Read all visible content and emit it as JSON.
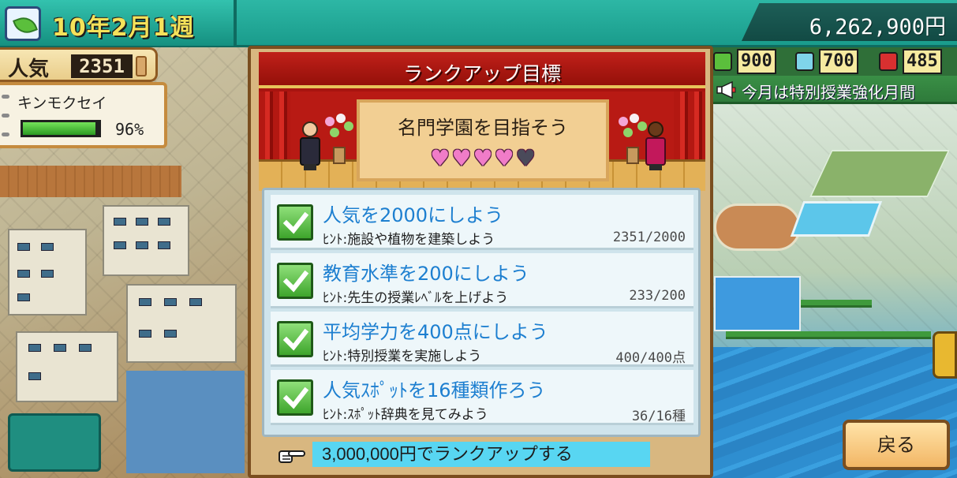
{
  "header": {
    "date": "10年2月1週",
    "money": "6,262,900円"
  },
  "popularity": {
    "label": "人気",
    "value": "2351"
  },
  "rival": {
    "name": "キンモクセイ",
    "percent_text": "96%",
    "percent": 96
  },
  "resources": [
    {
      "icon": "leaf-resource-icon",
      "value": "900",
      "color": "#5bbf3c"
    },
    {
      "icon": "flask-resource-icon",
      "value": "700",
      "color": "#7fd4ea"
    },
    {
      "icon": "book-resource-icon",
      "value": "485",
      "color": "#d83030"
    }
  ],
  "announcement": "今月は特別授業強化月間",
  "dialog": {
    "title": "ランクアップ目標",
    "goal_heading": "名門学園を目指そう",
    "hearts": {
      "filled": 4,
      "total": 5
    },
    "goals": [
      {
        "title": "人気を2000にしよう",
        "hint": "ﾋﾝﾄ:施設や植物を建築しよう",
        "progress": "2351/2000",
        "done": true
      },
      {
        "title": "教育水準を200にしよう",
        "hint": "ﾋﾝﾄ:先生の授業ﾚﾍﾞﾙを上げよう",
        "progress": "233/200",
        "done": true
      },
      {
        "title": "平均学力を400点にしよう",
        "hint": "ﾋﾝﾄ:特別授業を実施しよう",
        "progress": "400/400点",
        "done": true
      },
      {
        "title": "人気ｽﾎﾟｯﾄを16種類作ろう",
        "hint": "ﾋﾝﾄ:ｽﾎﾟｯﾄ辞典を見てみよう",
        "progress": "36/16種",
        "done": true
      }
    ],
    "rankup_label": "3,000,000円でランクアップする"
  },
  "back_label": "戻る",
  "colors": {
    "accent_teal": "#1a9c8c",
    "goal_title_blue": "#1d7fd0",
    "rankup_cyan": "#58d6f2",
    "heart_pink": "#f07cc8"
  }
}
